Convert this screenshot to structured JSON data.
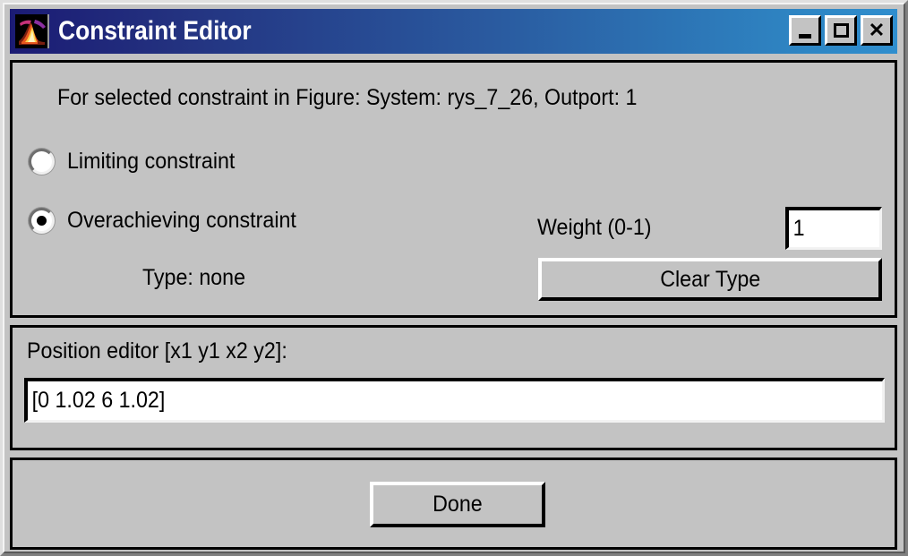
{
  "window": {
    "title": "Constraint Editor",
    "icon": "matlab-membrane-icon",
    "controls": {
      "minimize": "minimize-icon",
      "maximize": "maximize-icon",
      "close": "close-icon"
    },
    "colors": {
      "titlebar_gradient_start": "#1b1b74",
      "titlebar_gradient_end": "#2f8ece",
      "face": "#c3c3c3",
      "title_text": "#ffffff",
      "border": "#000000",
      "field_background": "#ffffff"
    }
  },
  "constraint_panel": {
    "header": "For selected constraint in Figure: System: rys_7_26, Outport: 1",
    "options": [
      {
        "label": "Limiting constraint",
        "selected": false
      },
      {
        "label": "Overachieving constraint",
        "selected": true
      }
    ],
    "type_line": "Type: none",
    "weight_label": "Weight (0-1)",
    "weight_value": "1",
    "clear_type_label": "Clear Type"
  },
  "position_panel": {
    "label": "Position editor [x1 y1 x2 y2]:",
    "value": "[0 1.02 6 1.02]"
  },
  "action_panel": {
    "done_label": "Done"
  }
}
